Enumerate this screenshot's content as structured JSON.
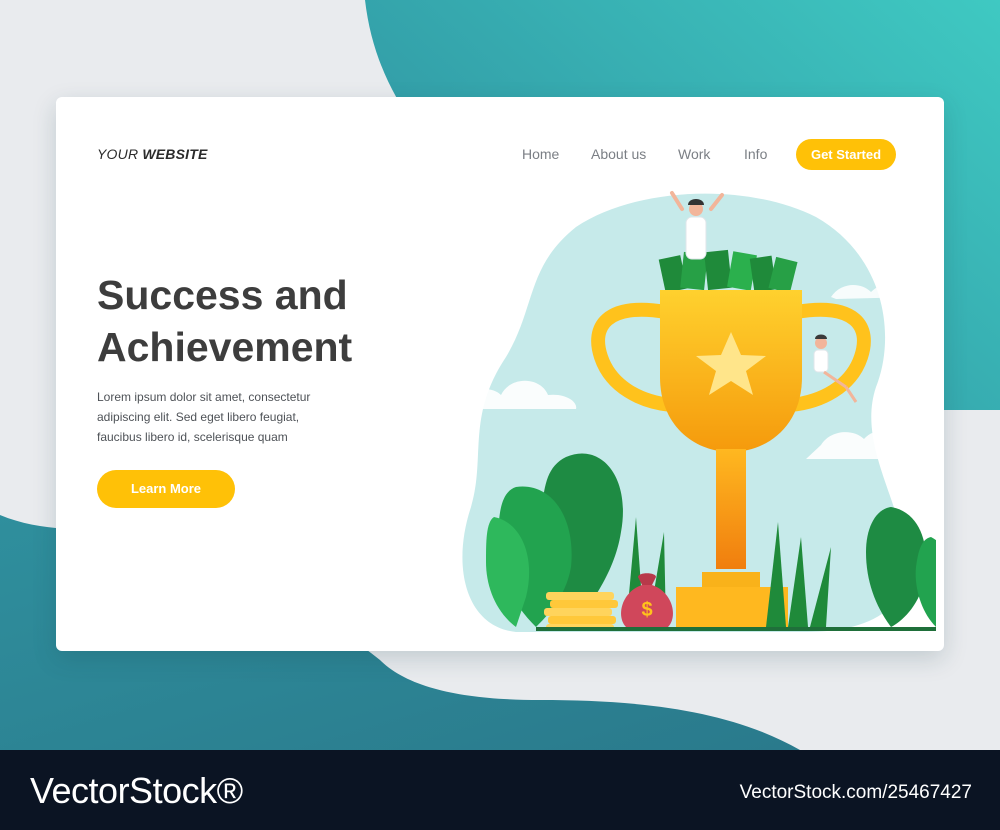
{
  "colors": {
    "accent": "#ffc107",
    "background_teal": "#2f8f9d",
    "footer": "#0b1423"
  },
  "header": {
    "brand_prefix": "YOUR",
    "brand_bold": "WEBSITE",
    "nav": [
      "Home",
      "About us",
      "Work",
      "Info"
    ],
    "cta_label": "Get Started"
  },
  "hero": {
    "title_line1": "Success and",
    "title_line2": "Achievement",
    "body": "Lorem ipsum dolor sit amet, consectetur adipiscing elit. Sed eget libero feugiat, faucibus libero id, scelerisque quam",
    "button_label": "Learn More"
  },
  "illustration": {
    "icons": [
      "trophy-icon",
      "star-icon",
      "money-bag-icon",
      "coin-stack-icon",
      "person-icon",
      "cash-stack-icon",
      "leaf-icon"
    ],
    "money_bag_symbol": "$"
  },
  "watermark": {
    "logo": "VectorStock®",
    "url": "VectorStock.com/25467427"
  }
}
